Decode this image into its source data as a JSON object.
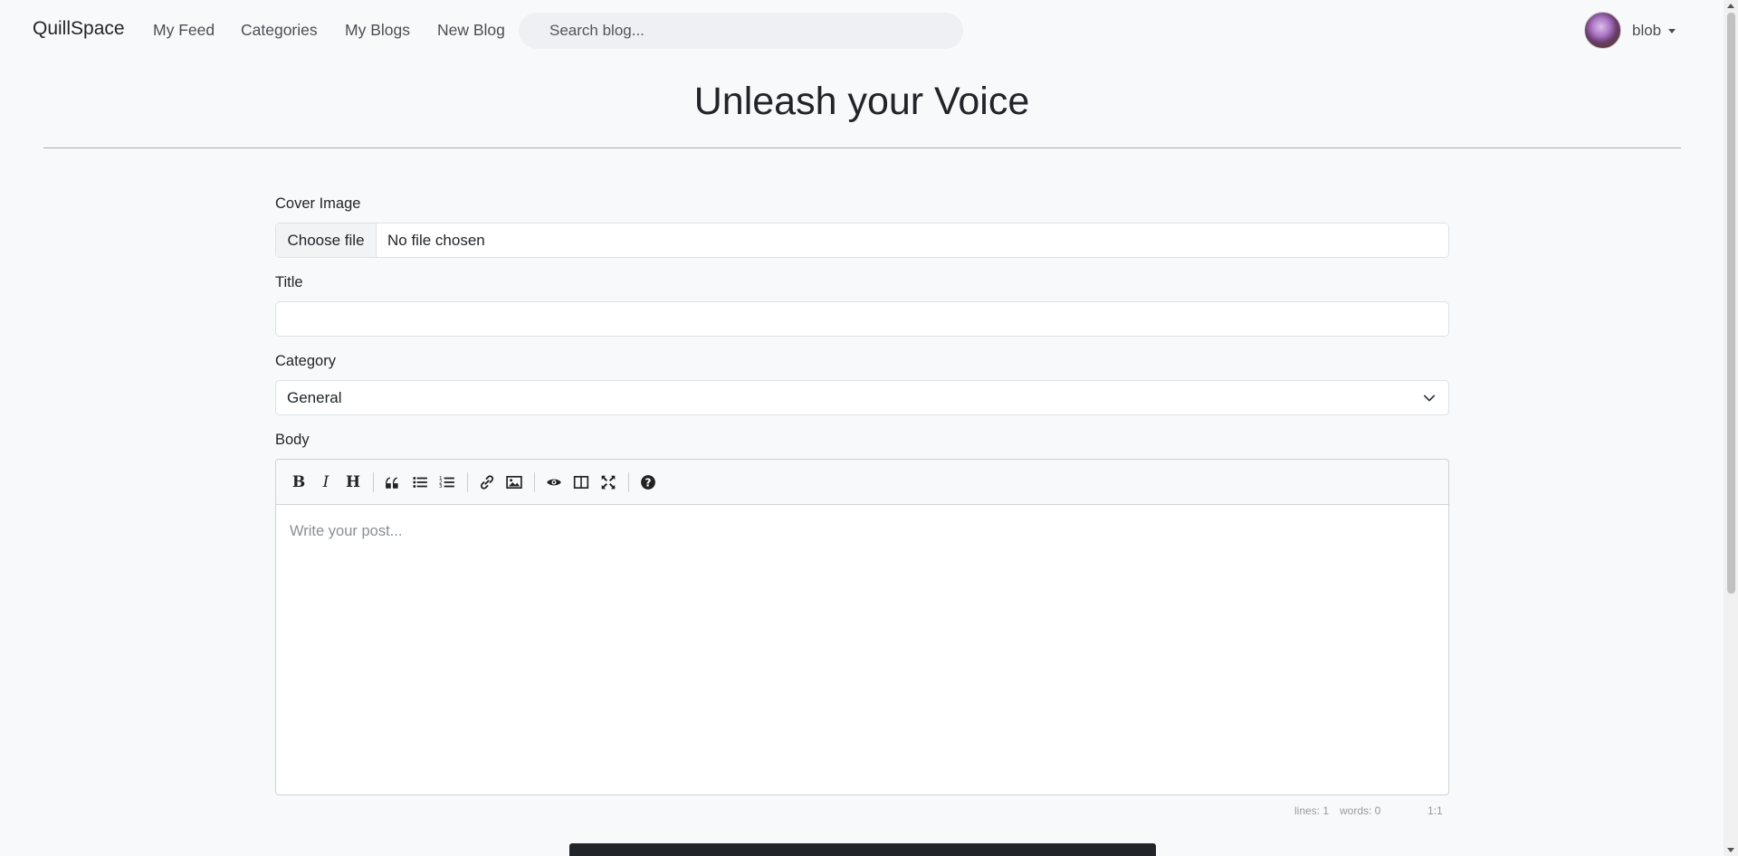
{
  "nav": {
    "brand": "QuillSpace",
    "links": [
      "My Feed",
      "Categories",
      "My Blogs",
      "New Blog"
    ],
    "search_placeholder": "Search blog...",
    "username": "blob"
  },
  "page": {
    "title": "Unleash your Voice"
  },
  "form": {
    "cover_label": "Cover Image",
    "file_button": "Choose file",
    "file_status": "No file chosen",
    "title_label": "Title",
    "title_value": "",
    "category_label": "Category",
    "category_selected": "General",
    "body_label": "Body",
    "body_placeholder": "Write your post..."
  },
  "editor": {
    "toolbar": [
      "bold-icon",
      "italic-icon",
      "heading-icon",
      "quote-icon",
      "unordered-list-icon",
      "ordered-list-icon",
      "link-icon",
      "image-icon",
      "preview-icon",
      "side-by-side-icon",
      "fullscreen-icon",
      "help-icon"
    ],
    "status": {
      "lines": "lines: 1",
      "words": "words: 0",
      "cursor": "1:1"
    }
  }
}
